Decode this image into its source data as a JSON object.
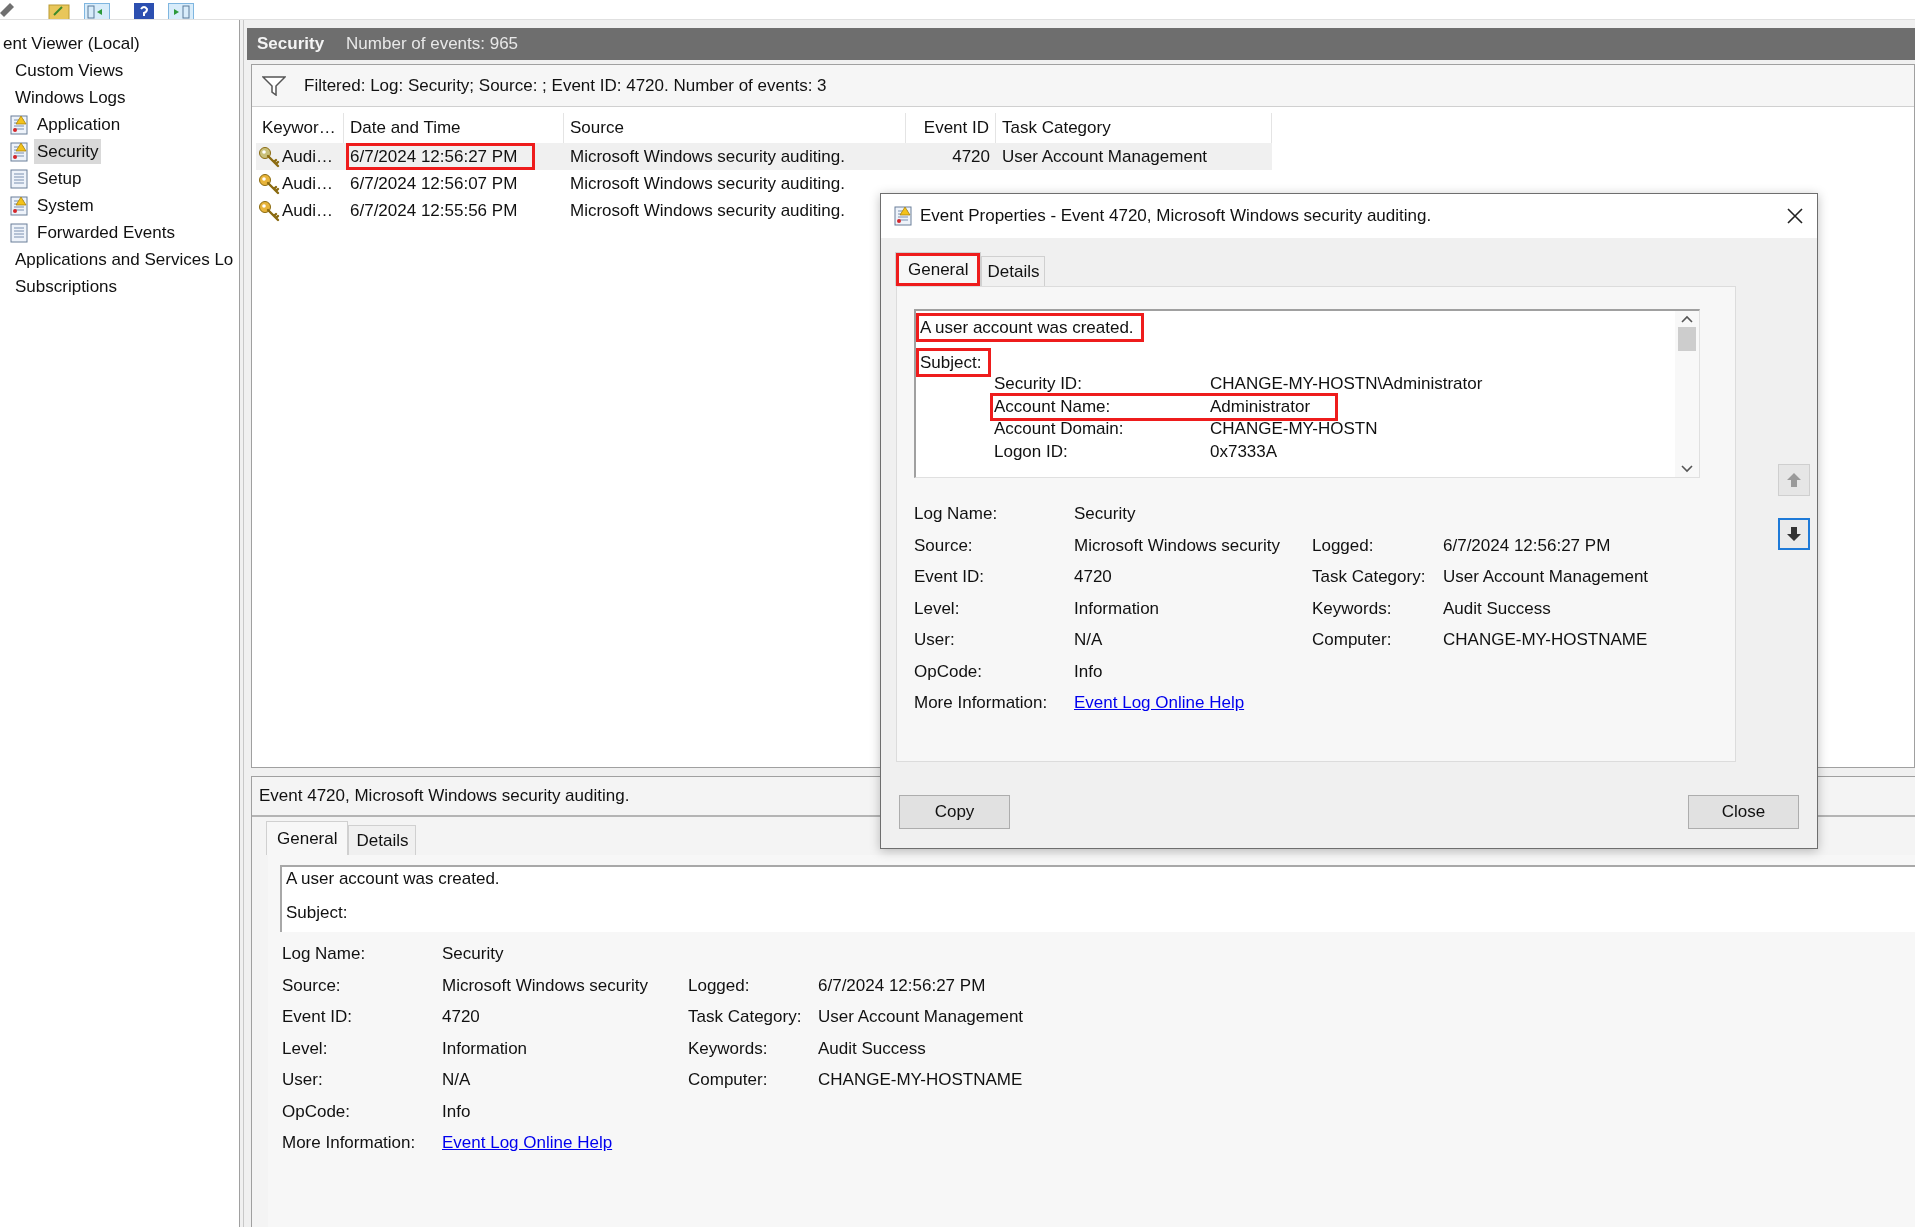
{
  "tree": {
    "items": [
      {
        "label": "ent Viewer (Local)",
        "selected": false,
        "children": [
          {
            "label": "Custom Views",
            "selected": false
          },
          {
            "label": "Windows Logs",
            "selected": false,
            "children": [
              {
                "label": "Application",
                "selected": false,
                "kind": "warn"
              },
              {
                "label": "Security",
                "selected": true,
                "kind": "warn"
              },
              {
                "label": "Setup",
                "selected": false,
                "kind": "plain"
              },
              {
                "label": "System",
                "selected": false,
                "kind": "warn"
              },
              {
                "label": "Forwarded Events",
                "selected": false,
                "kind": "plain"
              }
            ]
          },
          {
            "label": "Applications and Services Lo",
            "selected": false
          },
          {
            "label": "Subscriptions",
            "selected": false
          }
        ]
      }
    ]
  },
  "header": {
    "title": "Security",
    "count": "Number of events: 965"
  },
  "filter": "Filtered: Log: Security; Source: ; Event ID: 4720. Number of events: 3",
  "table": {
    "columns": [
      "Keywor…",
      "Date and Time",
      "Source",
      "Event ID",
      "Task Category"
    ],
    "rows": [
      {
        "selected": true,
        "keywords": "Audi…",
        "date": "6/7/2024 12:56:27 PM",
        "date_highlighted": true,
        "source": "Microsoft Windows security auditing.",
        "event_id": "4720",
        "task_category": "User Account Management"
      },
      {
        "selected": false,
        "keywords": "Audi…",
        "date": "6/7/2024 12:56:07 PM",
        "date_highlighted": false,
        "source": "Microsoft Windows security auditing."
      },
      {
        "selected": false,
        "keywords": "Audi…",
        "date": "6/7/2024 12:55:56 PM",
        "date_highlighted": false,
        "source": "Microsoft Windows security auditing."
      }
    ]
  },
  "preview": {
    "title": "Event 4720, Microsoft Windows security auditing.",
    "tabs": [
      {
        "label": "General",
        "selected": true
      },
      {
        "label": "Details",
        "selected": false
      }
    ],
    "message": [
      "A user account was created.",
      "Subject:"
    ],
    "fields": [
      {
        "label": "Log Name:",
        "value": "Security"
      },
      {
        "label": "Source:",
        "value": "Microsoft Windows security",
        "label_2": "Logged:",
        "value_2": "6/7/2024 12:56:27 PM"
      },
      {
        "label": "Event ID:",
        "value": "4720",
        "label_2": "Task Category:",
        "value_2": "User Account Management"
      },
      {
        "label": "Level:",
        "value": "Information",
        "label_2": "Keywords:",
        "value_2": "Audit Success"
      },
      {
        "label": "User:",
        "value": "N/A",
        "label_2": "Computer:",
        "value_2": "CHANGE-MY-HOSTNAME"
      },
      {
        "label": "OpCode:",
        "value": "Info"
      }
    ],
    "more_info": {
      "label": "More Information:",
      "link": "Event Log Online Help"
    }
  },
  "dialog": {
    "title": "Event Properties - Event 4720, Microsoft Windows security auditing.",
    "tabs": [
      {
        "label": "General",
        "selected": true,
        "highlighted": true
      },
      {
        "label": "Details",
        "selected": false,
        "highlighted": false
      }
    ],
    "message": [
      {
        "kind": "line",
        "text": "A user account was created.",
        "highlighted": true
      },
      {
        "kind": "line",
        "text": "Subject:",
        "highlighted": true
      },
      {
        "kind": "field",
        "label": "Security ID:",
        "value": "CHANGE-MY-HOSTN\\Administrator",
        "highlighted": false
      },
      {
        "kind": "field",
        "label": "Account Name:",
        "value": "Administrator",
        "highlighted": true
      },
      {
        "kind": "field",
        "label": "Account Domain:",
        "value": "CHANGE-MY-HOSTN",
        "highlighted": false
      },
      {
        "kind": "field",
        "label": "Logon ID:",
        "value": "0x7333A",
        "highlighted": false
      }
    ],
    "fields": [
      {
        "label": "Log Name:",
        "value": "Security"
      },
      {
        "label": "Source:",
        "value": "Microsoft Windows security",
        "label_2": "Logged:",
        "value_2": "6/7/2024 12:56:27 PM"
      },
      {
        "label": "Event ID:",
        "value": "4720",
        "label_2": "Task Category:",
        "value_2": "User Account Management"
      },
      {
        "label": "Level:",
        "value": "Information",
        "label_2": "Keywords:",
        "value_2": "Audit Success"
      },
      {
        "label": "User:",
        "value": "N/A",
        "label_2": "Computer:",
        "value_2": "CHANGE-MY-HOSTNAME"
      },
      {
        "label": "OpCode:",
        "value": "Info"
      }
    ],
    "more_info": {
      "label": "More Information:",
      "link": "Event Log Online Help"
    },
    "buttons": [
      "Copy",
      "Close"
    ]
  }
}
